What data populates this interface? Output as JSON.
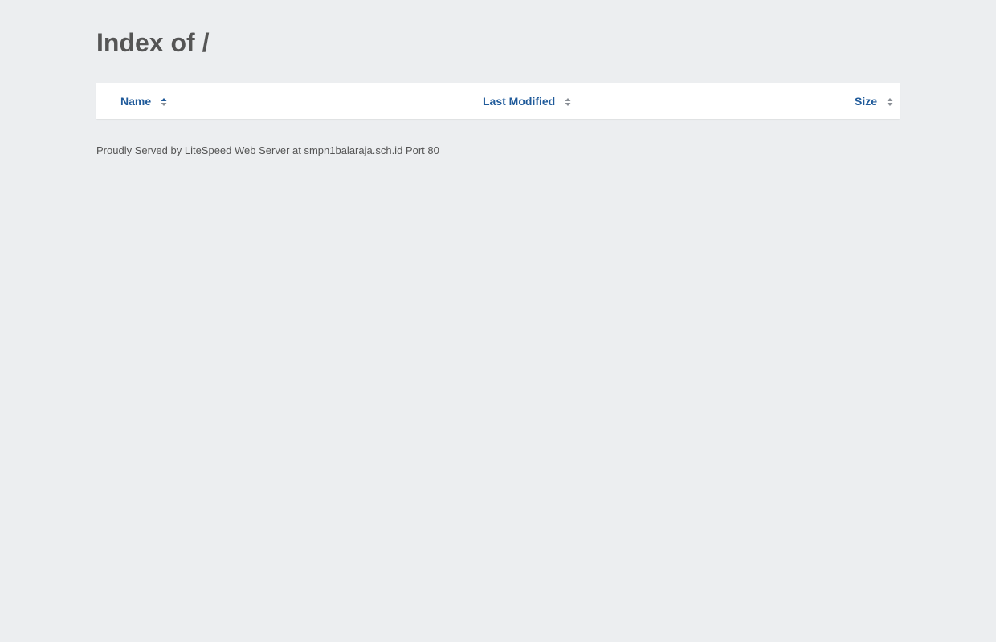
{
  "page": {
    "title": "Index of /"
  },
  "table": {
    "headers": {
      "name": "Name",
      "last_modified": "Last Modified",
      "size": "Size"
    },
    "rows": []
  },
  "footer": {
    "text": "Proudly Served by LiteSpeed Web Server at smpn1balaraja.sch.id Port 80"
  },
  "icons": {
    "sort": "sort-icon"
  },
  "colors": {
    "background": "#eceef0",
    "link": "#1f5a9a",
    "text": "#555555",
    "sort_icon": "#8a8f96"
  }
}
